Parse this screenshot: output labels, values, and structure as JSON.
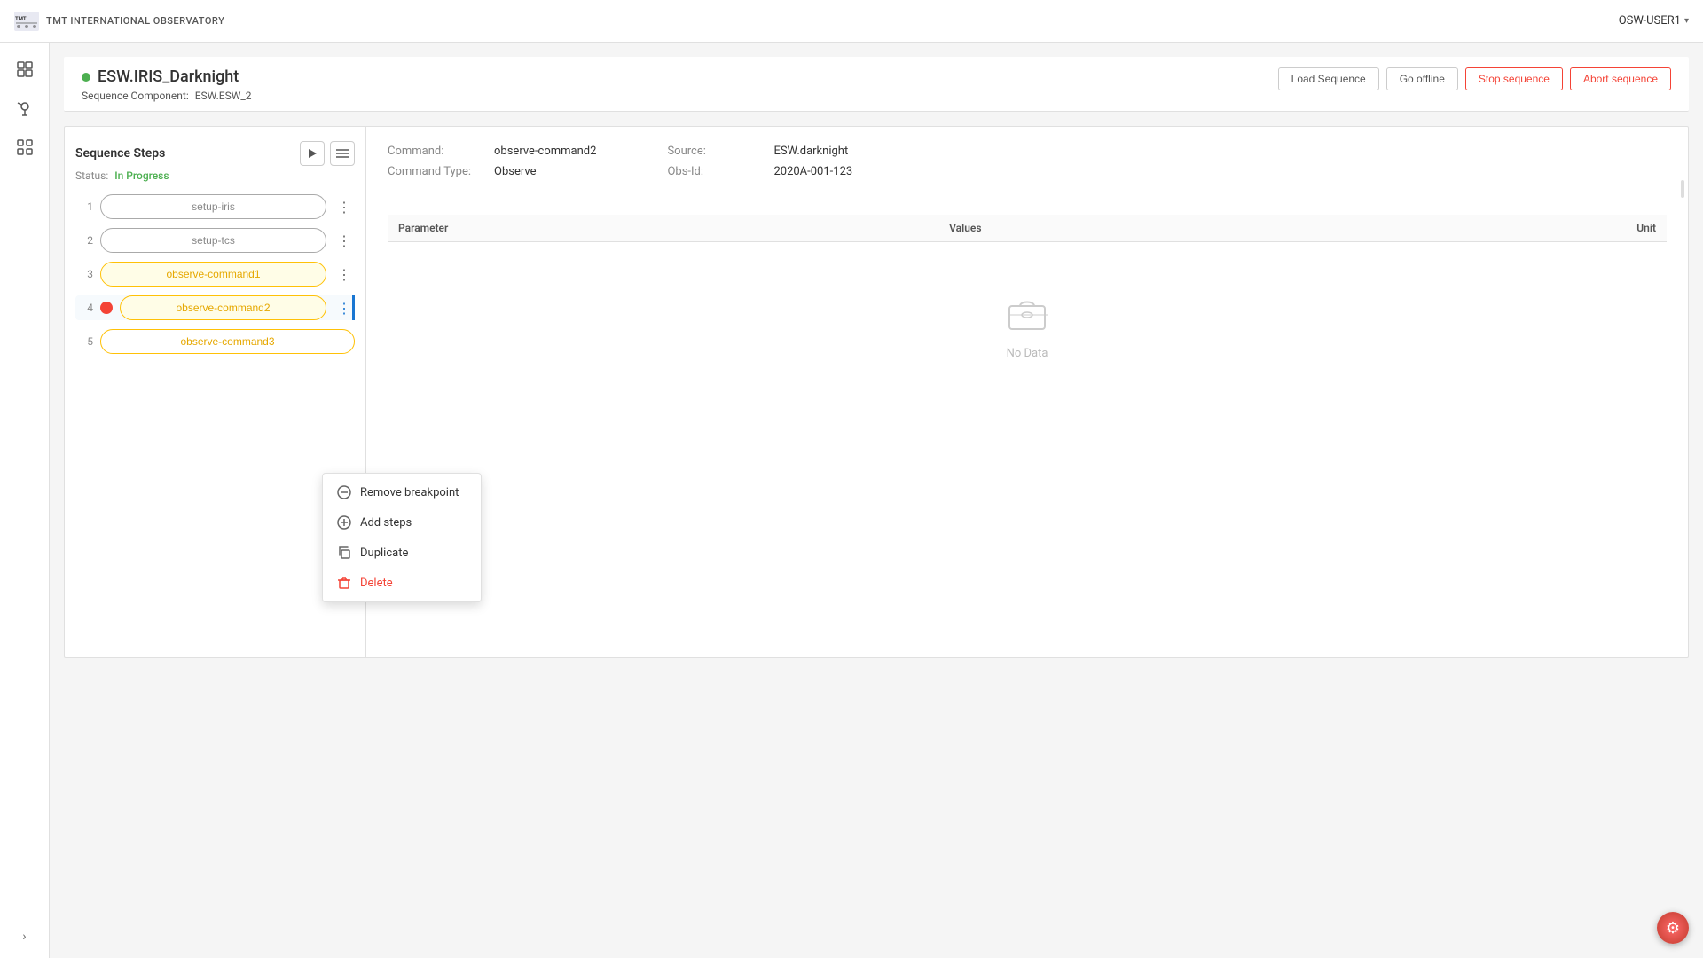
{
  "header": {
    "logo_text": "TMT INTERNATIONAL OBSERVATORY",
    "user": "OSW-USER1"
  },
  "sidebar": {
    "icons": [
      {
        "name": "grid-icon",
        "symbol": "⊞"
      },
      {
        "name": "telescope-icon",
        "symbol": "🔭"
      },
      {
        "name": "apps-icon",
        "symbol": "⊟"
      }
    ],
    "expand_label": "›"
  },
  "sequence": {
    "title": "ESW.IRIS_Darknight",
    "status_dot_color": "#4caf50",
    "component_label": "Sequence Component:",
    "component_value": "ESW.ESW_2",
    "buttons": {
      "load": "Load Sequence",
      "go_offline": "Go offline",
      "stop": "Stop sequence",
      "abort": "Abort sequence"
    }
  },
  "steps_panel": {
    "title": "Sequence Steps",
    "status_label": "Status:",
    "status_value": "In Progress",
    "steps": [
      {
        "num": "1",
        "label": "setup-iris",
        "state": "completed"
      },
      {
        "num": "2",
        "label": "setup-tcs",
        "state": "completed"
      },
      {
        "num": "3",
        "label": "observe-command1",
        "state": "in-progress"
      },
      {
        "num": "4",
        "label": "observe-command2",
        "state": "in-progress",
        "breakpoint": true,
        "active": true
      },
      {
        "num": "5",
        "label": "observe-command3",
        "state": "pending"
      }
    ]
  },
  "detail_panel": {
    "command_label": "Command:",
    "command_value": "observe-command2",
    "source_label": "Source:",
    "source_value": "ESW.darknight",
    "type_label": "Command Type:",
    "type_value": "Observe",
    "obs_id_label": "Obs-Id:",
    "obs_id_value": "2020A-001-123",
    "table": {
      "columns": [
        "Parameter",
        "Values",
        "Unit"
      ],
      "rows": [],
      "empty_text": "No Data"
    }
  },
  "context_menu": {
    "items": [
      {
        "id": "remove-breakpoint",
        "label": "Remove breakpoint",
        "icon": "⊖",
        "danger": false
      },
      {
        "id": "add-steps",
        "label": "Add steps",
        "icon": "⊕",
        "danger": false
      },
      {
        "id": "duplicate",
        "label": "Duplicate",
        "icon": "⧉",
        "danger": false
      },
      {
        "id": "delete",
        "label": "Delete",
        "icon": "🗑",
        "danger": true
      }
    ]
  },
  "gear": {
    "symbol": "⚙"
  }
}
